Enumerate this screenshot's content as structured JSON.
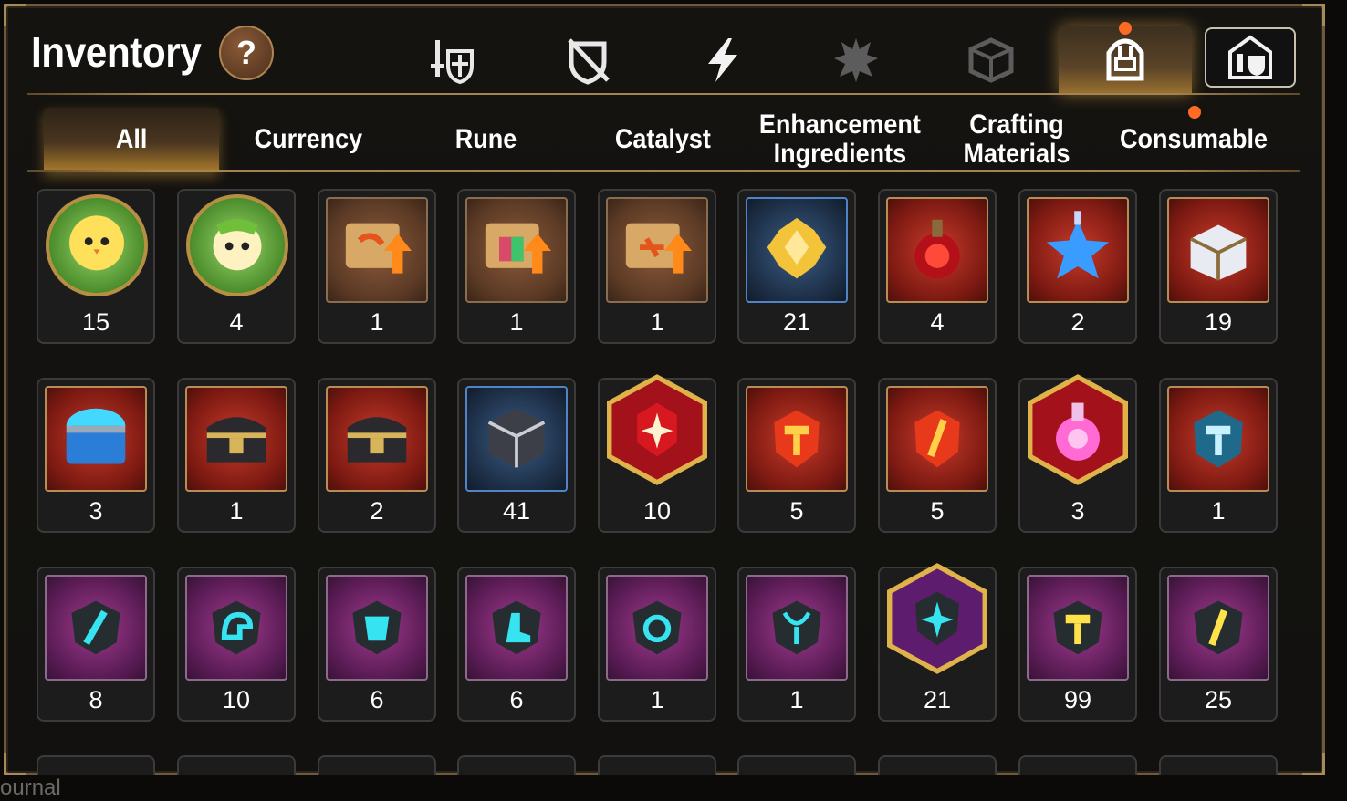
{
  "header": {
    "title": "Inventory",
    "help_label": "?"
  },
  "category_tabs": [
    {
      "icon": "sword-shield-icon"
    },
    {
      "icon": "crossed-shield-icon"
    },
    {
      "icon": "lightning-icon"
    },
    {
      "icon": "spiky-creature-icon"
    },
    {
      "icon": "cube-icon"
    },
    {
      "icon": "backpack-icon",
      "active": true,
      "notification": true
    },
    {
      "icon": "castle-icon"
    }
  ],
  "sub_tabs": [
    {
      "label": "All",
      "active": true
    },
    {
      "label": "Currency"
    },
    {
      "label": "Rune"
    },
    {
      "label": "Catalyst"
    },
    {
      "label": "Enhancement Ingredients"
    },
    {
      "label": "Crafting Materials"
    },
    {
      "label": "Consumable",
      "notification": true
    }
  ],
  "items": [
    {
      "icon": "yellow-bird-token-icon",
      "count": "15"
    },
    {
      "icon": "green-bird-token-icon",
      "count": "4"
    },
    {
      "icon": "dragon-scroll-icon",
      "count": "1"
    },
    {
      "icon": "rainbow-scroll-icon",
      "count": "1"
    },
    {
      "icon": "rune-scroll-icon",
      "count": "1"
    },
    {
      "icon": "gold-crystal-icon",
      "count": "21"
    },
    {
      "icon": "red-potion-icon",
      "count": "4"
    },
    {
      "icon": "blue-star-potion-icon",
      "count": "2"
    },
    {
      "icon": "silver-chest-icon",
      "count": "19"
    },
    {
      "icon": "blue-chest-icon",
      "count": "3"
    },
    {
      "icon": "black-gold-chest-icon",
      "count": "1"
    },
    {
      "icon": "black-gold-chest-icon",
      "count": "2"
    },
    {
      "icon": "silver-cube-icon",
      "count": "41"
    },
    {
      "icon": "red-star-rune-icon",
      "count": "10"
    },
    {
      "icon": "red-hammer-rune-icon",
      "count": "5"
    },
    {
      "icon": "red-sword-rune-icon",
      "count": "5"
    },
    {
      "icon": "pink-potion-icon",
      "count": "3"
    },
    {
      "icon": "blue-hammer-rune-icon",
      "count": "1"
    },
    {
      "icon": "cyan-sword-stone-icon",
      "count": "8"
    },
    {
      "icon": "cyan-helmet-stone-icon",
      "count": "10"
    },
    {
      "icon": "cyan-armor-stone-icon",
      "count": "6"
    },
    {
      "icon": "cyan-boot-stone-icon",
      "count": "6"
    },
    {
      "icon": "cyan-ring-stone-icon",
      "count": "1"
    },
    {
      "icon": "cyan-necklace-stone-icon",
      "count": "1"
    },
    {
      "icon": "cyan-star-stone-icon",
      "count": "21"
    },
    {
      "icon": "gold-hammer-stone-icon",
      "count": "99"
    },
    {
      "icon": "gold-sword-stone-icon",
      "count": "25"
    }
  ],
  "background_text": "ournal",
  "colors": {
    "accent_gold": "#a3834f",
    "notification": "#ff6a24",
    "panel_bg": "#141310"
  }
}
